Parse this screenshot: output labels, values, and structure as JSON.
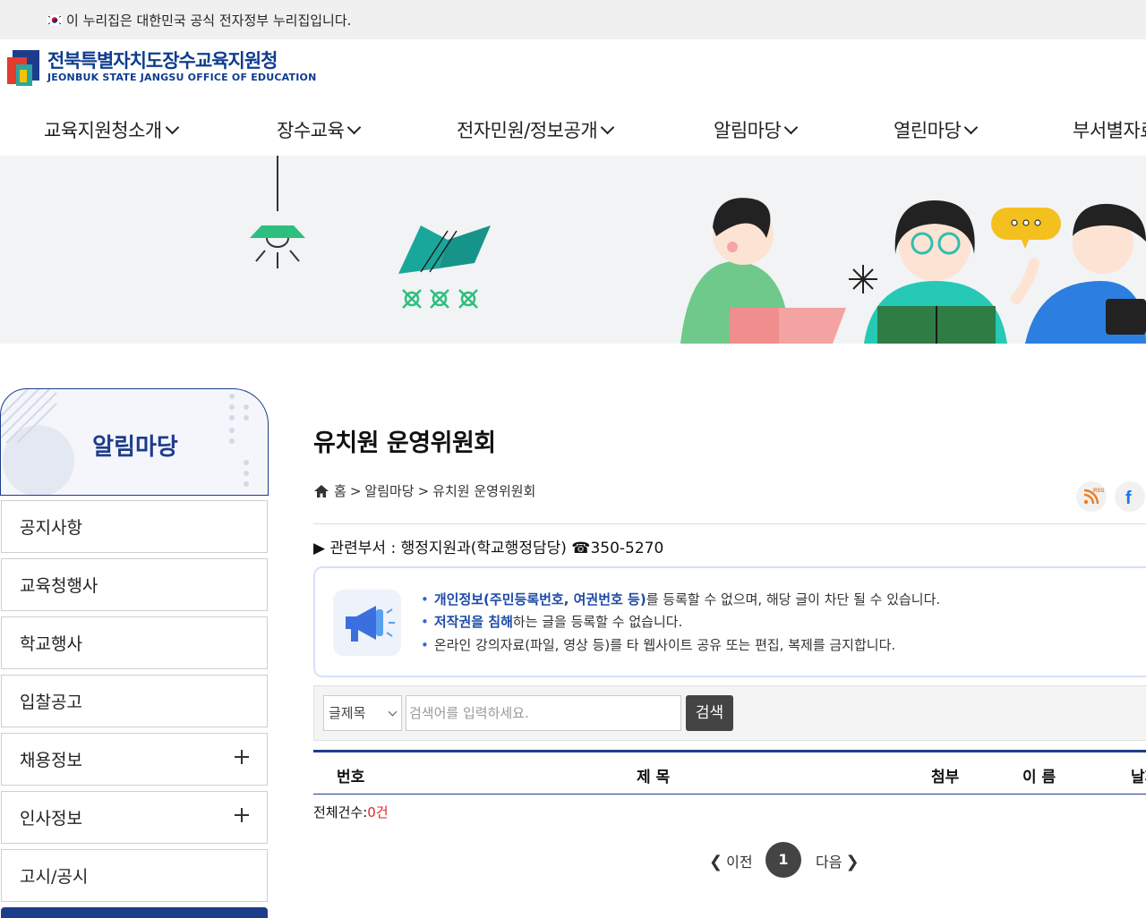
{
  "gov_bar": {
    "text": "이 누리집은 대한민국 공식 전자정부 누리집입니다."
  },
  "logo": {
    "name_ko": "전북특별자치도장수교육지원청",
    "name_en": "JEONBUK STATE JANGSU OFFICE OF EDUCATION"
  },
  "gnb": [
    {
      "label": "교육지원청소개"
    },
    {
      "label": "장수교육"
    },
    {
      "label": "전자민원/정보공개"
    },
    {
      "label": "알림마당"
    },
    {
      "label": "열린마당"
    },
    {
      "label": "부서별자료"
    }
  ],
  "sidebar": {
    "title": "알림마당",
    "items": [
      {
        "label": "공지사항",
        "expandable": false
      },
      {
        "label": "교육청행사",
        "expandable": false
      },
      {
        "label": "학교행사",
        "expandable": false
      },
      {
        "label": "입찰공고",
        "expandable": false
      },
      {
        "label": "채용정보",
        "expandable": true
      },
      {
        "label": "인사정보",
        "expandable": true
      },
      {
        "label": "고시/공시",
        "expandable": false
      }
    ]
  },
  "page": {
    "title": "유치원 운영위원회",
    "breadcrumb": [
      "홈",
      ">",
      "알림마당",
      ">",
      "유치원 운영위원회"
    ],
    "dept": "▶ 관련부서 : 행정지원과(학교행정담당) ☎350-5270"
  },
  "notice": {
    "line1_bold": "개인정보(주민등록번호, 여권번호 등)",
    "line1_rest": "를 등록할 수 없으며, 해당 글이 차단 될 수 있습니다.",
    "line2_bold": "저작권을 침해",
    "line2_rest": "하는 글을 등록할 수 없습니다.",
    "line3": "온라인 강의자료(파일, 영상 등)를 타 웹사이트 공유 또는 편집, 복제를 금지합니다."
  },
  "search": {
    "select_value": "글제목",
    "placeholder": "검색어를 입력하세요.",
    "button": "검색"
  },
  "table": {
    "headers": [
      "번호",
      "제 목",
      "첨부",
      "이 름",
      "날짜"
    ]
  },
  "total": {
    "label": "전체건수:",
    "count": "0건"
  },
  "pager": {
    "prev": "이전",
    "current": "1",
    "next": "다음"
  },
  "share": {
    "rss": "RSS",
    "facebook": "f"
  },
  "colors": {
    "brand": "#1d3c8a",
    "accent_red": "#e0262c",
    "banner_bg": "#f2f3f5"
  }
}
